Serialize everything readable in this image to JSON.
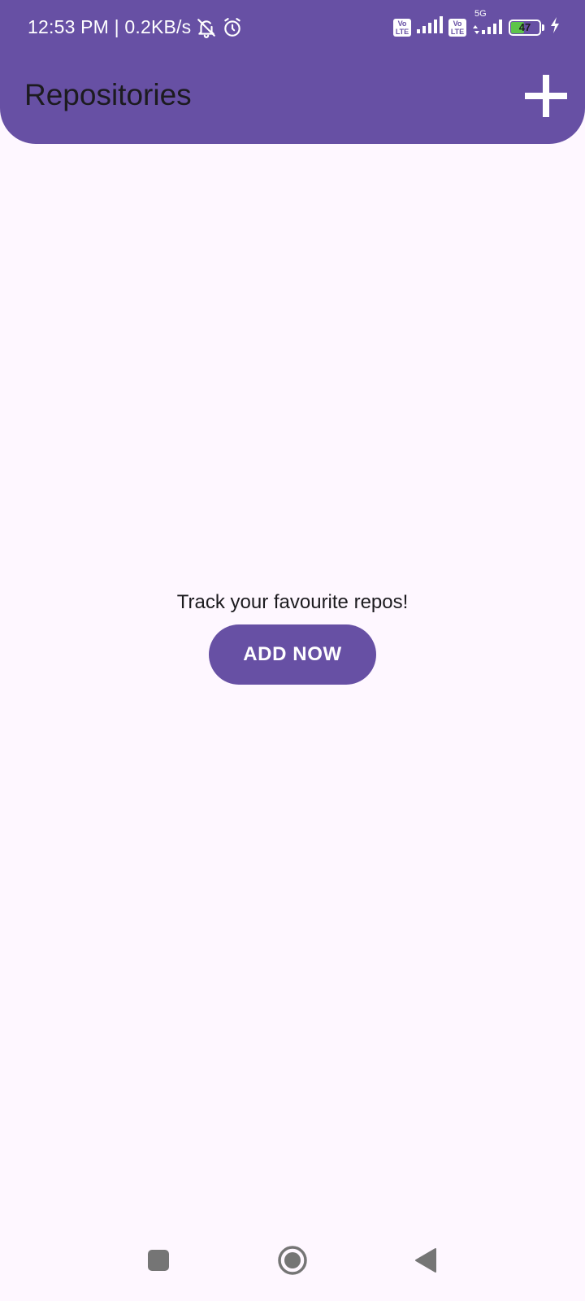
{
  "status_bar": {
    "time_speed": "12:53 PM | 0.2KB/s",
    "volte_1": "Vo LTE",
    "volte_2": "Vo LTE",
    "network_gen": "5G",
    "battery_level": "47",
    "battery_fraction": 0.47
  },
  "header": {
    "title": "Repositories",
    "add_icon": "plus-icon"
  },
  "empty_state": {
    "message": "Track your favourite repos!",
    "button_label": "ADD NOW"
  },
  "nav": {
    "recents_icon": "square-icon",
    "home_icon": "circle-icon",
    "back_icon": "triangle-back-icon"
  },
  "colors": {
    "primary": "#6750a4",
    "background": "#fef7ff",
    "on_surface": "#1c1b1f",
    "battery": "#5dc44a",
    "nav_icon": "#757575"
  }
}
